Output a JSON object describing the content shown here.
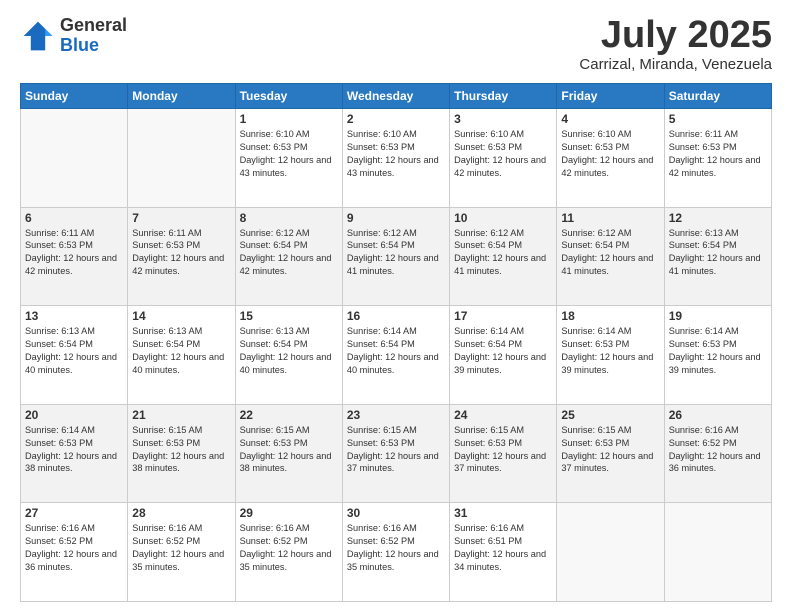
{
  "logo": {
    "general": "General",
    "blue": "Blue"
  },
  "title": "July 2025",
  "location": "Carrizal, Miranda, Venezuela",
  "days_of_week": [
    "Sunday",
    "Monday",
    "Tuesday",
    "Wednesday",
    "Thursday",
    "Friday",
    "Saturday"
  ],
  "weeks": [
    [
      {
        "day": "",
        "sunrise": "",
        "sunset": "",
        "daylight": ""
      },
      {
        "day": "",
        "sunrise": "",
        "sunset": "",
        "daylight": ""
      },
      {
        "day": "1",
        "sunrise": "Sunrise: 6:10 AM",
        "sunset": "Sunset: 6:53 PM",
        "daylight": "Daylight: 12 hours and 43 minutes."
      },
      {
        "day": "2",
        "sunrise": "Sunrise: 6:10 AM",
        "sunset": "Sunset: 6:53 PM",
        "daylight": "Daylight: 12 hours and 43 minutes."
      },
      {
        "day": "3",
        "sunrise": "Sunrise: 6:10 AM",
        "sunset": "Sunset: 6:53 PM",
        "daylight": "Daylight: 12 hours and 42 minutes."
      },
      {
        "day": "4",
        "sunrise": "Sunrise: 6:10 AM",
        "sunset": "Sunset: 6:53 PM",
        "daylight": "Daylight: 12 hours and 42 minutes."
      },
      {
        "day": "5",
        "sunrise": "Sunrise: 6:11 AM",
        "sunset": "Sunset: 6:53 PM",
        "daylight": "Daylight: 12 hours and 42 minutes."
      }
    ],
    [
      {
        "day": "6",
        "sunrise": "Sunrise: 6:11 AM",
        "sunset": "Sunset: 6:53 PM",
        "daylight": "Daylight: 12 hours and 42 minutes."
      },
      {
        "day": "7",
        "sunrise": "Sunrise: 6:11 AM",
        "sunset": "Sunset: 6:53 PM",
        "daylight": "Daylight: 12 hours and 42 minutes."
      },
      {
        "day": "8",
        "sunrise": "Sunrise: 6:12 AM",
        "sunset": "Sunset: 6:54 PM",
        "daylight": "Daylight: 12 hours and 42 minutes."
      },
      {
        "day": "9",
        "sunrise": "Sunrise: 6:12 AM",
        "sunset": "Sunset: 6:54 PM",
        "daylight": "Daylight: 12 hours and 41 minutes."
      },
      {
        "day": "10",
        "sunrise": "Sunrise: 6:12 AM",
        "sunset": "Sunset: 6:54 PM",
        "daylight": "Daylight: 12 hours and 41 minutes."
      },
      {
        "day": "11",
        "sunrise": "Sunrise: 6:12 AM",
        "sunset": "Sunset: 6:54 PM",
        "daylight": "Daylight: 12 hours and 41 minutes."
      },
      {
        "day": "12",
        "sunrise": "Sunrise: 6:13 AM",
        "sunset": "Sunset: 6:54 PM",
        "daylight": "Daylight: 12 hours and 41 minutes."
      }
    ],
    [
      {
        "day": "13",
        "sunrise": "Sunrise: 6:13 AM",
        "sunset": "Sunset: 6:54 PM",
        "daylight": "Daylight: 12 hours and 40 minutes."
      },
      {
        "day": "14",
        "sunrise": "Sunrise: 6:13 AM",
        "sunset": "Sunset: 6:54 PM",
        "daylight": "Daylight: 12 hours and 40 minutes."
      },
      {
        "day": "15",
        "sunrise": "Sunrise: 6:13 AM",
        "sunset": "Sunset: 6:54 PM",
        "daylight": "Daylight: 12 hours and 40 minutes."
      },
      {
        "day": "16",
        "sunrise": "Sunrise: 6:14 AM",
        "sunset": "Sunset: 6:54 PM",
        "daylight": "Daylight: 12 hours and 40 minutes."
      },
      {
        "day": "17",
        "sunrise": "Sunrise: 6:14 AM",
        "sunset": "Sunset: 6:54 PM",
        "daylight": "Daylight: 12 hours and 39 minutes."
      },
      {
        "day": "18",
        "sunrise": "Sunrise: 6:14 AM",
        "sunset": "Sunset: 6:53 PM",
        "daylight": "Daylight: 12 hours and 39 minutes."
      },
      {
        "day": "19",
        "sunrise": "Sunrise: 6:14 AM",
        "sunset": "Sunset: 6:53 PM",
        "daylight": "Daylight: 12 hours and 39 minutes."
      }
    ],
    [
      {
        "day": "20",
        "sunrise": "Sunrise: 6:14 AM",
        "sunset": "Sunset: 6:53 PM",
        "daylight": "Daylight: 12 hours and 38 minutes."
      },
      {
        "day": "21",
        "sunrise": "Sunrise: 6:15 AM",
        "sunset": "Sunset: 6:53 PM",
        "daylight": "Daylight: 12 hours and 38 minutes."
      },
      {
        "day": "22",
        "sunrise": "Sunrise: 6:15 AM",
        "sunset": "Sunset: 6:53 PM",
        "daylight": "Daylight: 12 hours and 38 minutes."
      },
      {
        "day": "23",
        "sunrise": "Sunrise: 6:15 AM",
        "sunset": "Sunset: 6:53 PM",
        "daylight": "Daylight: 12 hours and 37 minutes."
      },
      {
        "day": "24",
        "sunrise": "Sunrise: 6:15 AM",
        "sunset": "Sunset: 6:53 PM",
        "daylight": "Daylight: 12 hours and 37 minutes."
      },
      {
        "day": "25",
        "sunrise": "Sunrise: 6:15 AM",
        "sunset": "Sunset: 6:53 PM",
        "daylight": "Daylight: 12 hours and 37 minutes."
      },
      {
        "day": "26",
        "sunrise": "Sunrise: 6:16 AM",
        "sunset": "Sunset: 6:52 PM",
        "daylight": "Daylight: 12 hours and 36 minutes."
      }
    ],
    [
      {
        "day": "27",
        "sunrise": "Sunrise: 6:16 AM",
        "sunset": "Sunset: 6:52 PM",
        "daylight": "Daylight: 12 hours and 36 minutes."
      },
      {
        "day": "28",
        "sunrise": "Sunrise: 6:16 AM",
        "sunset": "Sunset: 6:52 PM",
        "daylight": "Daylight: 12 hours and 35 minutes."
      },
      {
        "day": "29",
        "sunrise": "Sunrise: 6:16 AM",
        "sunset": "Sunset: 6:52 PM",
        "daylight": "Daylight: 12 hours and 35 minutes."
      },
      {
        "day": "30",
        "sunrise": "Sunrise: 6:16 AM",
        "sunset": "Sunset: 6:52 PM",
        "daylight": "Daylight: 12 hours and 35 minutes."
      },
      {
        "day": "31",
        "sunrise": "Sunrise: 6:16 AM",
        "sunset": "Sunset: 6:51 PM",
        "daylight": "Daylight: 12 hours and 34 minutes."
      },
      {
        "day": "",
        "sunrise": "",
        "sunset": "",
        "daylight": ""
      },
      {
        "day": "",
        "sunrise": "",
        "sunset": "",
        "daylight": ""
      }
    ]
  ]
}
